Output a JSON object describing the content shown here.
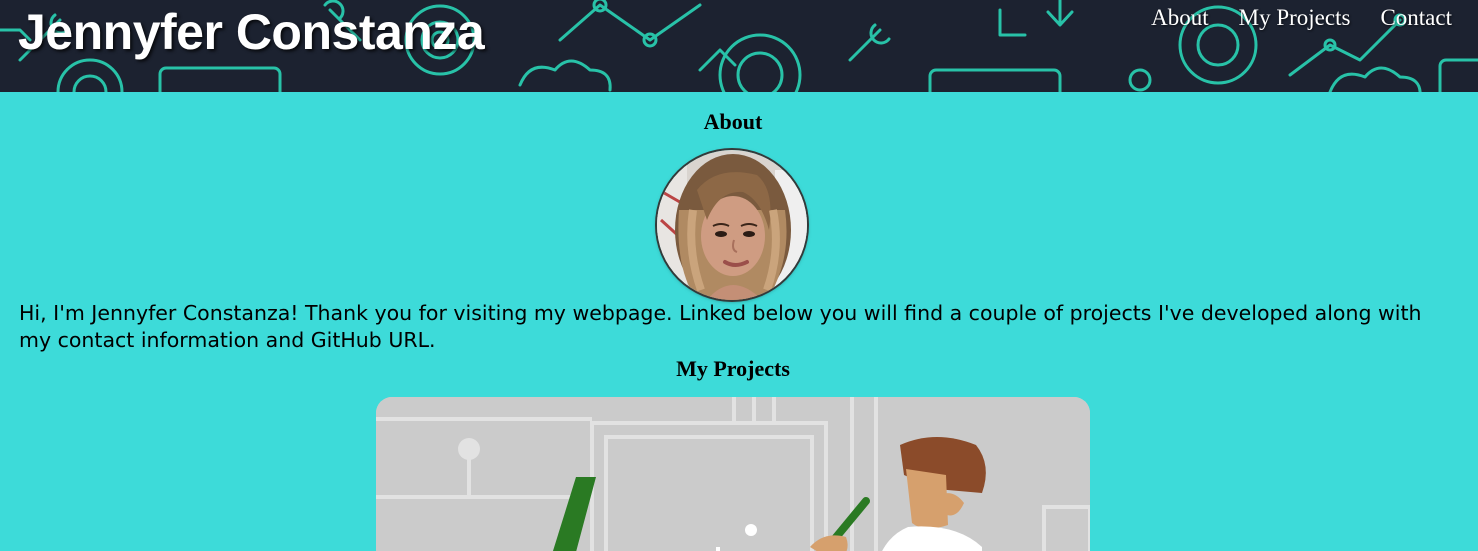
{
  "header": {
    "title": "Jennyfer Constanza",
    "nav": [
      "About",
      "My Projects",
      "Contact"
    ]
  },
  "about": {
    "heading": "About",
    "text": "Hi, I'm Jennyfer Constanza! Thank you for visiting my webpage. Linked below you will find a couple of projects I've developed along with my contact information and GitHub URL."
  },
  "projects": {
    "heading": "My Projects"
  },
  "colors": {
    "page_background": "#3ddbd9",
    "header_background": "#1c2230",
    "header_pattern": "#2ad4b5",
    "card_background": "#cbcbcb"
  }
}
